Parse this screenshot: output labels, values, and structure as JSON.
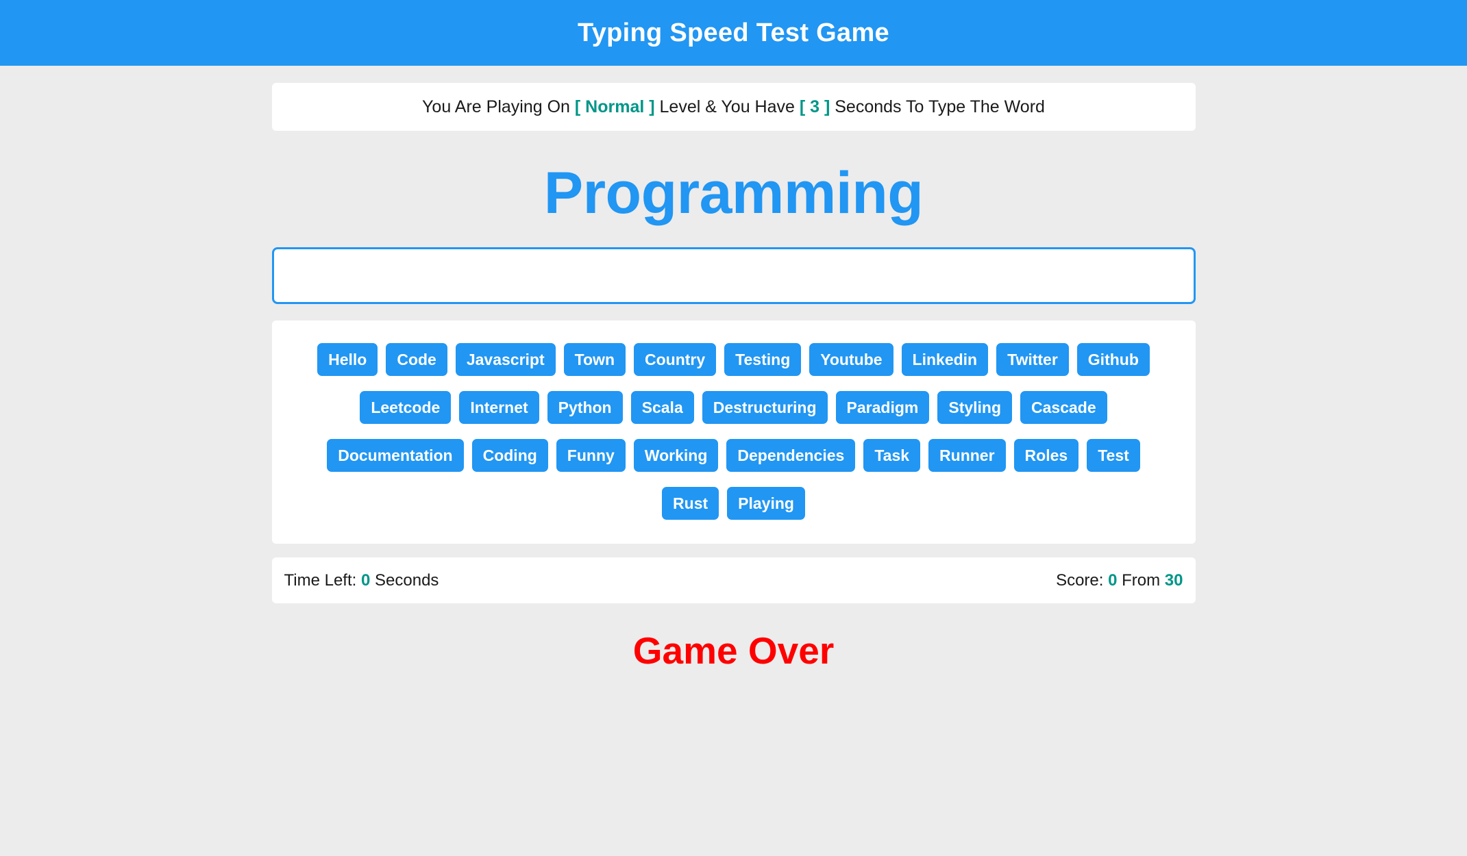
{
  "header": {
    "title": "Typing Speed Test Game",
    "bg_color": "#2196f3",
    "text_color": "#ffffff"
  },
  "info": {
    "prefix": "You Are Playing On ",
    "level": "[ Normal ]",
    "middle": " Level & You Have ",
    "seconds": "[ 3 ]",
    "suffix": " Seconds To Type The Word",
    "highlight_color": "#009688"
  },
  "word": {
    "current": "Programming",
    "color": "#2196f3"
  },
  "input": {
    "value": "",
    "placeholder": "",
    "border_color": "#2196f3"
  },
  "words_list": {
    "chip_color": "#2196f3",
    "chip_text_color": "#ffffff",
    "rows": [
      [
        "Hello",
        "Code",
        "Javascript",
        "Town",
        "Country",
        "Testing",
        "Youtube",
        "Linkedin",
        "Twitter",
        "Github"
      ],
      [
        "Leetcode",
        "Internet",
        "Python",
        "Scala",
        "Destructuring",
        "Paradigm",
        "Styling",
        "Cascade"
      ],
      [
        "Documentation",
        "Coding",
        "Funny",
        "Working",
        "Dependencies",
        "Task",
        "Runner",
        "Roles",
        "Test"
      ],
      [
        "Rust",
        "Playing"
      ]
    ]
  },
  "status": {
    "time_label": "Time Left: ",
    "time_value": "0",
    "time_unit": " Seconds",
    "score_label": "Score: ",
    "score_value": "0",
    "score_from_label": " From ",
    "score_total": "30",
    "highlight_color": "#009688"
  },
  "result": {
    "message": "Game Over",
    "color": "#ff0000"
  }
}
